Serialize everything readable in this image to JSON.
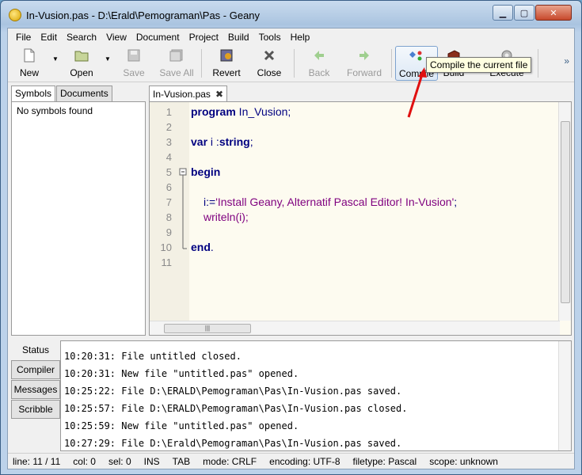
{
  "window": {
    "title": "In-Vusion.pas - D:\\Erald\\Pemograman\\Pas - Geany",
    "controls": [
      "minimize",
      "maximize",
      "close"
    ]
  },
  "menu": [
    "File",
    "Edit",
    "Search",
    "View",
    "Document",
    "Project",
    "Build",
    "Tools",
    "Help"
  ],
  "toolbar": {
    "new": "New",
    "open": "Open",
    "save": "Save",
    "save_all": "Save All",
    "revert": "Revert",
    "close": "Close",
    "back": "Back",
    "forward": "Forward",
    "compile": "Compile",
    "build": "Build",
    "execute": "Execute",
    "more": "»"
  },
  "tooltip": "Compile the current file",
  "sidebar": {
    "tabs": [
      "Symbols",
      "Documents"
    ],
    "content": "No symbols found"
  },
  "editor": {
    "tab_label": "In-Vusion.pas",
    "line_numbers": [
      "1",
      "2",
      "3",
      "4",
      "5",
      "6",
      "7",
      "8",
      "9",
      "10",
      "11"
    ],
    "code": {
      "l1_kw": "program",
      "l1_rest": " In_Vusion;",
      "l3_kw": "var",
      "l3_rest": " i :",
      "l3_type": "string",
      "l3_end": ";",
      "l5_kw": "begin",
      "l7_id": "i:=",
      "l7_str": "'Install Geany, Alternatif Pascal Editor! In-Vusion'",
      "l7_end": ";",
      "l8_fn": "writeln(",
      "l8_arg": "i",
      "l8_end": ");",
      "l10_kw": "end",
      "l10_end": "."
    }
  },
  "message_tabs": [
    "Status",
    "Compiler",
    "Messages",
    "Scribble"
  ],
  "log": [
    "10:20:31: File untitled closed.",
    "10:20:31: New file \"untitled.pas\" opened.",
    "10:25:22: File D:\\ERALD\\Pemograman\\Pas\\In-Vusion.pas saved.",
    "10:25:57: File D:\\ERALD\\Pemograman\\Pas\\In-Vusion.pas closed.",
    "10:25:59: New file \"untitled.pas\" opened.",
    "10:27:29: File D:\\Erald\\Pemograman\\Pas\\In-Vusion.pas saved."
  ],
  "status": {
    "line": "line: 11 / 11",
    "col": "col: 0",
    "sel": "sel: 0",
    "ins": "INS",
    "tab": "TAB",
    "mode": "mode: CRLF",
    "encoding": "encoding: UTF-8",
    "filetype": "filetype: Pascal",
    "scope": "scope: unknown"
  }
}
